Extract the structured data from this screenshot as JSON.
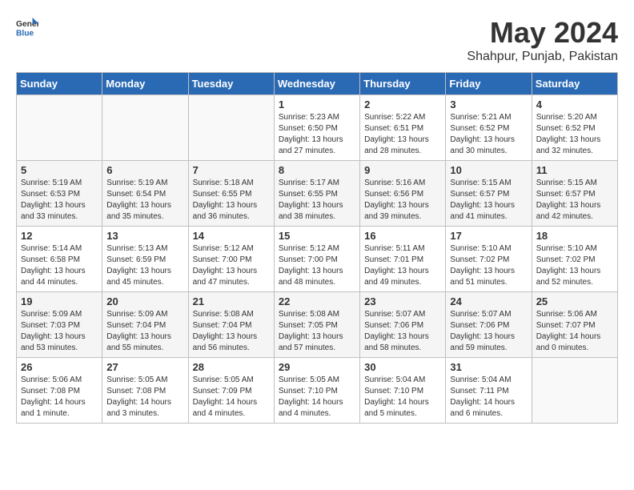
{
  "header": {
    "logo": {
      "general": "General",
      "blue": "Blue"
    },
    "title": "May 2024",
    "subtitle": "Shahpur, Punjab, Pakistan"
  },
  "weekdays": [
    "Sunday",
    "Monday",
    "Tuesday",
    "Wednesday",
    "Thursday",
    "Friday",
    "Saturday"
  ],
  "weeks": [
    [
      {
        "day": "",
        "info": ""
      },
      {
        "day": "",
        "info": ""
      },
      {
        "day": "",
        "info": ""
      },
      {
        "day": "1",
        "info": "Sunrise: 5:23 AM\nSunset: 6:50 PM\nDaylight: 13 hours and 27 minutes."
      },
      {
        "day": "2",
        "info": "Sunrise: 5:22 AM\nSunset: 6:51 PM\nDaylight: 13 hours and 28 minutes."
      },
      {
        "day": "3",
        "info": "Sunrise: 5:21 AM\nSunset: 6:52 PM\nDaylight: 13 hours and 30 minutes."
      },
      {
        "day": "4",
        "info": "Sunrise: 5:20 AM\nSunset: 6:52 PM\nDaylight: 13 hours and 32 minutes."
      }
    ],
    [
      {
        "day": "5",
        "info": "Sunrise: 5:19 AM\nSunset: 6:53 PM\nDaylight: 13 hours and 33 minutes."
      },
      {
        "day": "6",
        "info": "Sunrise: 5:19 AM\nSunset: 6:54 PM\nDaylight: 13 hours and 35 minutes."
      },
      {
        "day": "7",
        "info": "Sunrise: 5:18 AM\nSunset: 6:55 PM\nDaylight: 13 hours and 36 minutes."
      },
      {
        "day": "8",
        "info": "Sunrise: 5:17 AM\nSunset: 6:55 PM\nDaylight: 13 hours and 38 minutes."
      },
      {
        "day": "9",
        "info": "Sunrise: 5:16 AM\nSunset: 6:56 PM\nDaylight: 13 hours and 39 minutes."
      },
      {
        "day": "10",
        "info": "Sunrise: 5:15 AM\nSunset: 6:57 PM\nDaylight: 13 hours and 41 minutes."
      },
      {
        "day": "11",
        "info": "Sunrise: 5:15 AM\nSunset: 6:57 PM\nDaylight: 13 hours and 42 minutes."
      }
    ],
    [
      {
        "day": "12",
        "info": "Sunrise: 5:14 AM\nSunset: 6:58 PM\nDaylight: 13 hours and 44 minutes."
      },
      {
        "day": "13",
        "info": "Sunrise: 5:13 AM\nSunset: 6:59 PM\nDaylight: 13 hours and 45 minutes."
      },
      {
        "day": "14",
        "info": "Sunrise: 5:12 AM\nSunset: 7:00 PM\nDaylight: 13 hours and 47 minutes."
      },
      {
        "day": "15",
        "info": "Sunrise: 5:12 AM\nSunset: 7:00 PM\nDaylight: 13 hours and 48 minutes."
      },
      {
        "day": "16",
        "info": "Sunrise: 5:11 AM\nSunset: 7:01 PM\nDaylight: 13 hours and 49 minutes."
      },
      {
        "day": "17",
        "info": "Sunrise: 5:10 AM\nSunset: 7:02 PM\nDaylight: 13 hours and 51 minutes."
      },
      {
        "day": "18",
        "info": "Sunrise: 5:10 AM\nSunset: 7:02 PM\nDaylight: 13 hours and 52 minutes."
      }
    ],
    [
      {
        "day": "19",
        "info": "Sunrise: 5:09 AM\nSunset: 7:03 PM\nDaylight: 13 hours and 53 minutes."
      },
      {
        "day": "20",
        "info": "Sunrise: 5:09 AM\nSunset: 7:04 PM\nDaylight: 13 hours and 55 minutes."
      },
      {
        "day": "21",
        "info": "Sunrise: 5:08 AM\nSunset: 7:04 PM\nDaylight: 13 hours and 56 minutes."
      },
      {
        "day": "22",
        "info": "Sunrise: 5:08 AM\nSunset: 7:05 PM\nDaylight: 13 hours and 57 minutes."
      },
      {
        "day": "23",
        "info": "Sunrise: 5:07 AM\nSunset: 7:06 PM\nDaylight: 13 hours and 58 minutes."
      },
      {
        "day": "24",
        "info": "Sunrise: 5:07 AM\nSunset: 7:06 PM\nDaylight: 13 hours and 59 minutes."
      },
      {
        "day": "25",
        "info": "Sunrise: 5:06 AM\nSunset: 7:07 PM\nDaylight: 14 hours and 0 minutes."
      }
    ],
    [
      {
        "day": "26",
        "info": "Sunrise: 5:06 AM\nSunset: 7:08 PM\nDaylight: 14 hours and 1 minute."
      },
      {
        "day": "27",
        "info": "Sunrise: 5:05 AM\nSunset: 7:08 PM\nDaylight: 14 hours and 3 minutes."
      },
      {
        "day": "28",
        "info": "Sunrise: 5:05 AM\nSunset: 7:09 PM\nDaylight: 14 hours and 4 minutes."
      },
      {
        "day": "29",
        "info": "Sunrise: 5:05 AM\nSunset: 7:10 PM\nDaylight: 14 hours and 4 minutes."
      },
      {
        "day": "30",
        "info": "Sunrise: 5:04 AM\nSunset: 7:10 PM\nDaylight: 14 hours and 5 minutes."
      },
      {
        "day": "31",
        "info": "Sunrise: 5:04 AM\nSunset: 7:11 PM\nDaylight: 14 hours and 6 minutes."
      },
      {
        "day": "",
        "info": ""
      }
    ]
  ]
}
